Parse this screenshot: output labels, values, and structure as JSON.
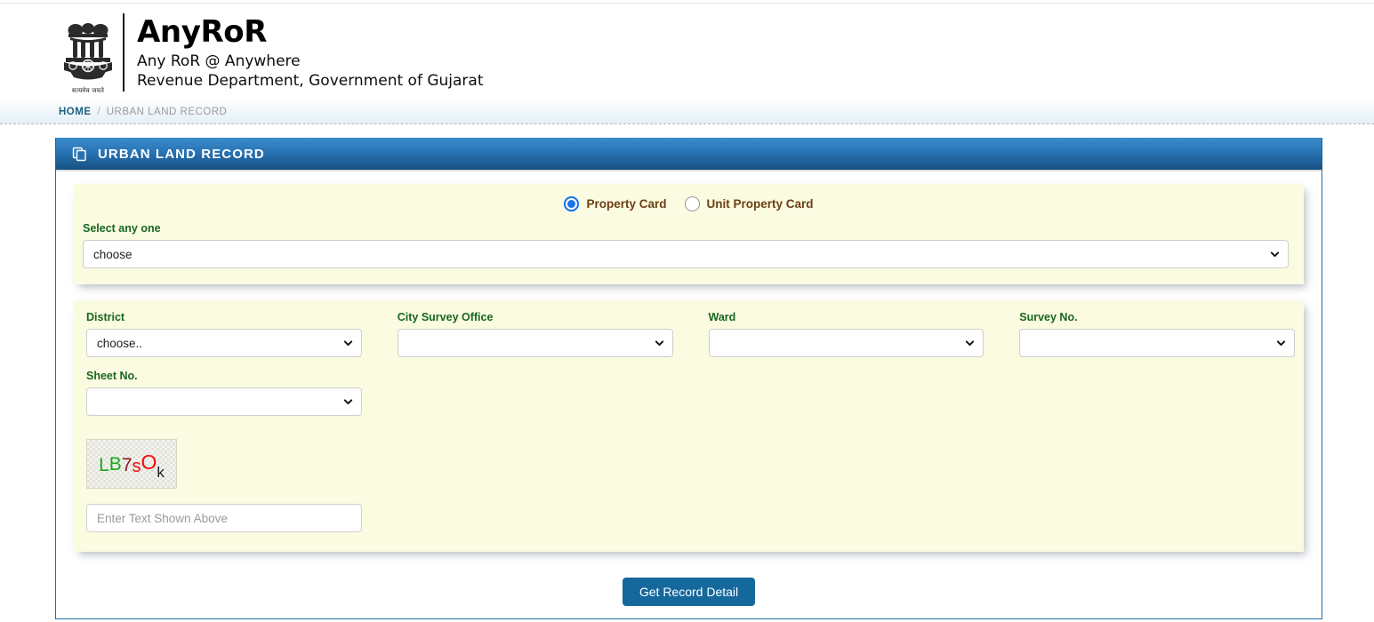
{
  "header": {
    "emblem_icon": "india-state-emblem-icon",
    "emblem_motto": "सत्यमेव जयते",
    "title": "AnyRoR",
    "subtitle1": "Any RoR @ Anywhere",
    "subtitle2": "Revenue Department, Government of Gujarat"
  },
  "breadcrumb": {
    "home": "HOME",
    "separator": "/",
    "current": "URBAN LAND RECORD"
  },
  "panel": {
    "icon": "copy-documents-icon",
    "title": "URBAN LAND RECORD",
    "border_color": "#1d6fa5",
    "head_gradient_from": "#3c8dcd",
    "head_gradient_to": "#17507e"
  },
  "card_colors": {
    "background": "#fbfbe1",
    "label_green": "#18661f",
    "radio_label_brown": "#6b3f13",
    "accent_blue": "#15689c"
  },
  "record_type": {
    "options": [
      {
        "label": "Property Card",
        "selected": true
      },
      {
        "label": "Unit Property Card",
        "selected": false
      }
    ]
  },
  "select_any_one": {
    "label": "Select any one",
    "value": "choose",
    "caret_icon": "chevron-down-icon"
  },
  "fields": [
    {
      "label": "District",
      "value": "choose..",
      "caret_icon": "chevron-down-icon"
    },
    {
      "label": "City Survey Office",
      "value": "",
      "caret_icon": "chevron-down-icon"
    },
    {
      "label": "Ward",
      "value": "",
      "caret_icon": "chevron-down-icon"
    },
    {
      "label": "Survey No.",
      "value": "",
      "caret_icon": "chevron-down-icon"
    }
  ],
  "sheet_no": {
    "label": "Sheet No.",
    "value": "",
    "caret_icon": "chevron-down-icon"
  },
  "captcha": {
    "text": "LB7sOk",
    "characters": [
      {
        "char": "L",
        "color": "#1aa81a"
      },
      {
        "char": "B",
        "color": "#1aa81a"
      },
      {
        "char": "7",
        "color": "#8f1b1b"
      },
      {
        "char": "s",
        "color": "#f40c0c"
      },
      {
        "char": "O",
        "color": "#f40c0c"
      },
      {
        "char": "k",
        "color": "#1b1b1b"
      }
    ],
    "input_placeholder": "Enter Text Shown Above",
    "input_value": ""
  },
  "submit": {
    "label": "Get Record Detail"
  }
}
